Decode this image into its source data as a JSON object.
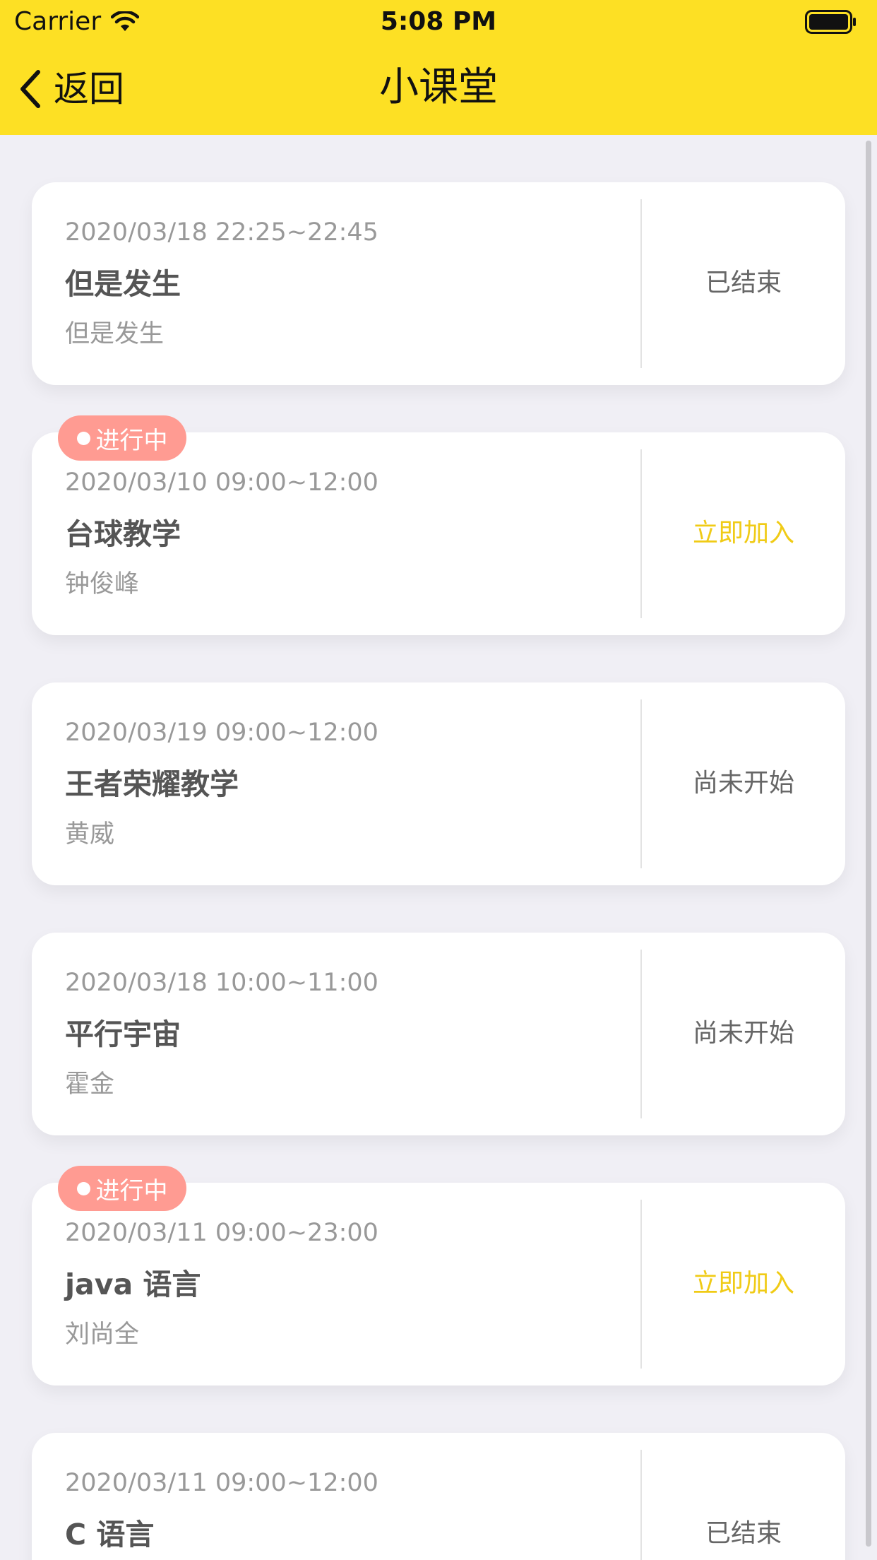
{
  "status_bar": {
    "carrier": "Carrier",
    "time": "5:08 PM"
  },
  "nav": {
    "back_label": "返回",
    "title": "小课堂"
  },
  "colors": {
    "header_bg": "#fde024",
    "join_text": "#f0cb16",
    "live_badge_bg": "#ff9b92"
  },
  "courses": [
    {
      "time": "2020/03/18 22:25~22:45",
      "title": "但是发生",
      "teacher": "但是发生",
      "status": "已结束",
      "badge": ""
    },
    {
      "time": "2020/03/10 09:00~12:00",
      "title": "台球教学",
      "teacher": "钟俊峰",
      "status": "立即加入",
      "badge": "进行中"
    },
    {
      "time": "2020/03/19 09:00~12:00",
      "title": "王者荣耀教学",
      "teacher": "黄威",
      "status": "尚未开始",
      "badge": ""
    },
    {
      "time": "2020/03/18 10:00~11:00",
      "title": "平行宇宙",
      "teacher": "霍金",
      "status": "尚未开始",
      "badge": ""
    },
    {
      "time": "2020/03/11 09:00~23:00",
      "title": "java 语言",
      "teacher": "刘尚全",
      "status": "立即加入",
      "badge": "进行中"
    },
    {
      "time": "2020/03/11 09:00~12:00",
      "title": "C 语言",
      "teacher": "",
      "status": "已结束",
      "badge": ""
    }
  ]
}
